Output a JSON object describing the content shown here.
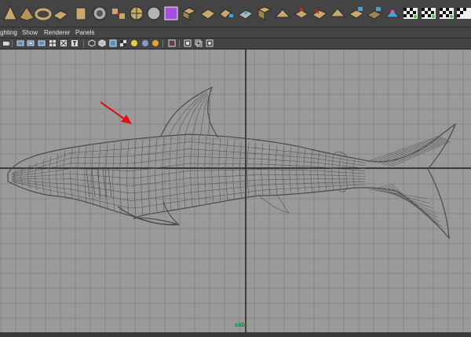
{
  "menubar": {
    "items": [
      "ghting",
      "Show",
      "Renderer",
      "Panels"
    ]
  },
  "viewport": {
    "camera_label": "side",
    "camera_label_color": "#0a8f4a",
    "background_color": "#9a9a9a",
    "grid_color": "#8a8a8a",
    "axis_color": "#1e1e1e",
    "mesh_color": "#555555",
    "annotation_arrow_color": "#e01010",
    "mesh_subject": "shark-wireframe"
  },
  "shelf": {
    "icons": [
      "cone-icon",
      "pyramid-icon",
      "torus-icon",
      "plane-icon",
      "torus-ring-icon",
      "cylinder-icon",
      "sphere-ring-icon",
      "merge-icon",
      "poly-sphere-icon",
      "cube-icon",
      "cube-select-icon",
      "extrude-icon",
      "bridge-icon",
      "append-icon",
      "split-icon",
      "wedge-icon",
      "extrude-face-icon",
      "bevel-icon",
      "poke-icon",
      "smooth-icon",
      "duplicate-icon",
      "sculpt-icon",
      "checker-icon",
      "checker-icon-2",
      "checker-icon-3",
      "checker-icon-4"
    ]
  },
  "panelbar": {
    "icons": [
      "camera-icon",
      "image-plane-icon",
      "film-gate-icon",
      "resolution-gate-icon",
      "grid-icon",
      "safe-action-icon",
      "text-icon",
      "wireframe-icon",
      "smooth-shade-icon",
      "texture-icon",
      "light-icon",
      "default-light-icon",
      "shadow-icon",
      "isolate-icon",
      "xray-icon",
      "xray-joints-icon",
      "backface-icon"
    ]
  }
}
